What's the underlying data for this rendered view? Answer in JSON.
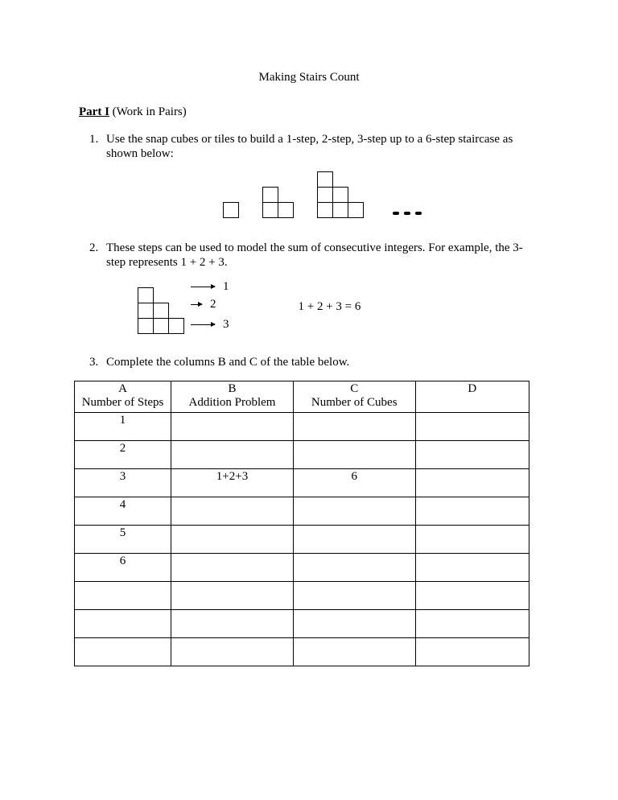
{
  "title": "Making Stairs Count",
  "part": {
    "label": "Part I",
    "paren": "(Work in Pairs)"
  },
  "items": {
    "i1": "Use the snap cubes or tiles to build a 1-step, 2-step, 3-step up to a 6-step staircase as shown below:",
    "i2": "These steps can be used to model the sum of consecutive integers. For example, the 3-step represents 1 + 2 + 3.",
    "i3": "Complete the columns B and C of the table below."
  },
  "diagram2": {
    "labels": {
      "r1": "1",
      "r2": "2",
      "r3": "3"
    },
    "equation": "1 + 2 + 3 = 6"
  },
  "chart_data": {
    "type": "table",
    "headers": {
      "A": {
        "letter": "A",
        "label": "Number of Steps"
      },
      "B": {
        "letter": "B",
        "label": "Addition Problem"
      },
      "C": {
        "letter": "C",
        "label": "Number of Cubes"
      },
      "D": {
        "letter": "D",
        "label": ""
      }
    },
    "rows": [
      {
        "A": "1",
        "B": "",
        "C": "",
        "D": ""
      },
      {
        "A": "2",
        "B": "",
        "C": "",
        "D": ""
      },
      {
        "A": "3",
        "B": "1+2+3",
        "C": "6",
        "D": ""
      },
      {
        "A": "4",
        "B": "",
        "C": "",
        "D": ""
      },
      {
        "A": "5",
        "B": "",
        "C": "",
        "D": ""
      },
      {
        "A": "6",
        "B": "",
        "C": "",
        "D": ""
      },
      {
        "A": "",
        "B": "",
        "C": "",
        "D": ""
      },
      {
        "A": "",
        "B": "",
        "C": "",
        "D": ""
      },
      {
        "A": "",
        "B": "",
        "C": "",
        "D": ""
      }
    ]
  }
}
